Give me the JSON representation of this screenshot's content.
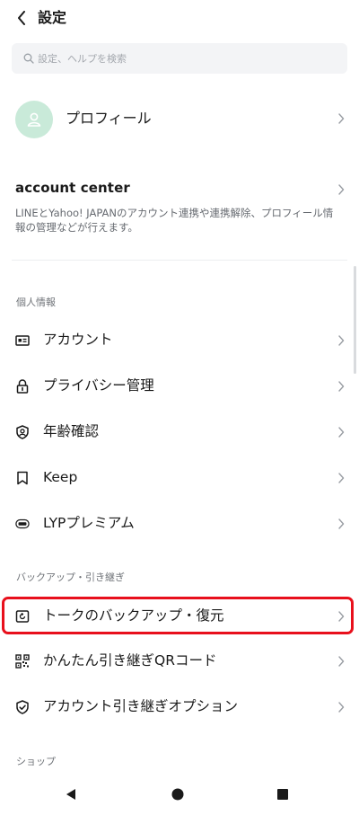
{
  "header": {
    "title": "設定"
  },
  "search": {
    "placeholder": "設定、ヘルプを検索"
  },
  "profile": {
    "label": "プロフィール"
  },
  "account_center": {
    "title": "account center",
    "description": "LINEとYahoo! JAPANのアカウント連携や連携解除、プロフィール情報の管理などが行えます。"
  },
  "sections": {
    "personal": {
      "title": "個人情報",
      "items": [
        {
          "label": "アカウント",
          "icon": "account-card-icon"
        },
        {
          "label": "プライバシー管理",
          "icon": "lock-icon"
        },
        {
          "label": "年齢確認",
          "icon": "age-shield-icon"
        },
        {
          "label": "Keep",
          "icon": "bookmark-icon"
        },
        {
          "label": "LYPプレミアム",
          "icon": "lyp-badge-icon"
        }
      ]
    },
    "backup": {
      "title": "バックアップ・引き継ぎ",
      "items": [
        {
          "label": "トークのバックアップ・復元",
          "icon": "backup-icon",
          "highlighted": true
        },
        {
          "label": "かんたん引き継ぎQRコード",
          "icon": "qr-code-icon"
        },
        {
          "label": "アカウント引き継ぎオプション",
          "icon": "shield-check-icon"
        }
      ]
    },
    "shop": {
      "title": "ショップ"
    }
  },
  "colors": {
    "highlight": "#e8101c",
    "avatar_bg": "#c9ead9",
    "search_bg": "#f3f4f6"
  }
}
